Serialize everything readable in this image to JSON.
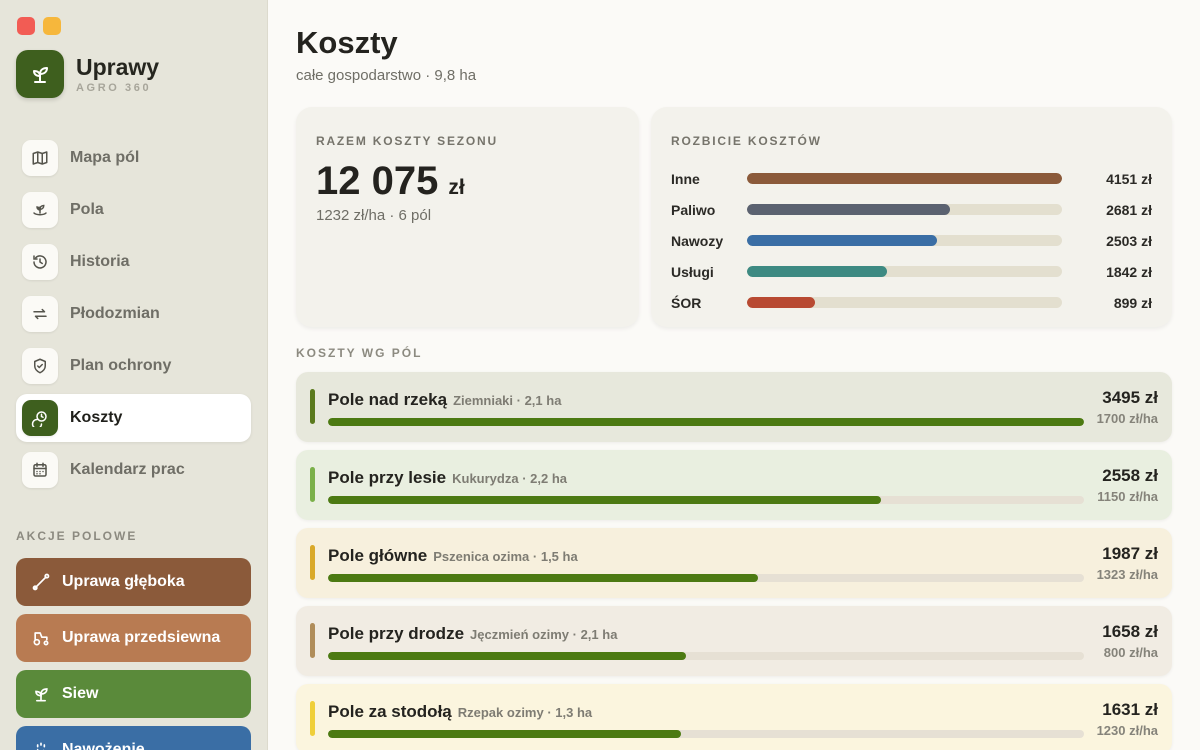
{
  "app": {
    "name": "Uprawy",
    "subtitle": "AGRO 360"
  },
  "nav": [
    {
      "label": "Mapa pól",
      "icon": "map-icon"
    },
    {
      "label": "Pola",
      "icon": "sprout-field-icon"
    },
    {
      "label": "Historia",
      "icon": "history-icon"
    },
    {
      "label": "Płodozmian",
      "icon": "rotation-icon"
    },
    {
      "label": "Plan ochrony",
      "icon": "shield-icon"
    },
    {
      "label": "Koszty",
      "icon": "cost-icon",
      "active": true
    },
    {
      "label": "Kalendarz prac",
      "icon": "calendar-icon"
    }
  ],
  "actions": {
    "title": "AKCJE POLOWE",
    "items": [
      {
        "label": "Uprawa głęboka",
        "color": "#8b5a3a",
        "icon": "plough-icon"
      },
      {
        "label": "Uprawa przedsiewna",
        "color": "#b87b52",
        "icon": "tractor-icon"
      },
      {
        "label": "Siew",
        "color": "#5a8a3a",
        "icon": "seedling-icon"
      },
      {
        "label": "Nawożenie",
        "color": "#3a6ea5",
        "icon": "fertilizer-icon"
      }
    ]
  },
  "page": {
    "title": "Koszty",
    "subtitle": "całe gospodarstwo · 9,8 ha"
  },
  "total": {
    "label": "RAZEM KOSZTY SEZONU",
    "value": "12 075",
    "unit": "zł",
    "sub": "1232 zł/ha · 6 pól"
  },
  "breakdown": {
    "label": "ROZBICIE KOSZTÓW",
    "rows": [
      {
        "name": "Inne",
        "value": "4151 zł",
        "fraction": 1.0,
        "color": "#8b5a3a"
      },
      {
        "name": "Paliwo",
        "value": "2681 zł",
        "fraction": 0.646,
        "color": "#5b6270"
      },
      {
        "name": "Nawozy",
        "value": "2503 zł",
        "fraction": 0.603,
        "color": "#3a6ea5"
      },
      {
        "name": "Usługi",
        "value": "1842 zł",
        "fraction": 0.444,
        "color": "#3d8a82"
      },
      {
        "name": "ŚOR",
        "value": "899 zł",
        "fraction": 0.217,
        "color": "#b84a32"
      }
    ]
  },
  "fields": {
    "title": "KOSZTY WG PÓL",
    "items": [
      {
        "name": "Pole nad rzeką",
        "crop": "Ziemniaki · 2,1 ha",
        "total": "3495 zł",
        "perha": "1700 zł/ha",
        "fraction": 1.0,
        "stripe": "#5b7a1e",
        "bg": "#e7e8dc"
      },
      {
        "name": "Pole przy lesie",
        "crop": "Kukurydza · 2,2 ha",
        "total": "2558 zł",
        "perha": "1150 zł/ha",
        "fraction": 0.732,
        "stripe": "#7bb04a",
        "bg": "#e9efe0"
      },
      {
        "name": "Pole główne",
        "crop": "Pszenica ozima · 1,5 ha",
        "total": "1987 zł",
        "perha": "1323 zł/ha",
        "fraction": 0.569,
        "stripe": "#d9a92a",
        "bg": "#f7f0dd"
      },
      {
        "name": "Pole przy drodze",
        "crop": "Jęczmień ozimy · 2,1 ha",
        "total": "1658 zł",
        "perha": "800 zł/ha",
        "fraction": 0.474,
        "stripe": "#b08d5a",
        "bg": "#f1ece3"
      },
      {
        "name": "Pole za stodołą",
        "crop": "Rzepak ozimy · 1,3 ha",
        "total": "1631 zł",
        "perha": "1230 zł/ha",
        "fraction": 0.467,
        "stripe": "#efcf3a",
        "bg": "#fbf5de"
      }
    ]
  }
}
